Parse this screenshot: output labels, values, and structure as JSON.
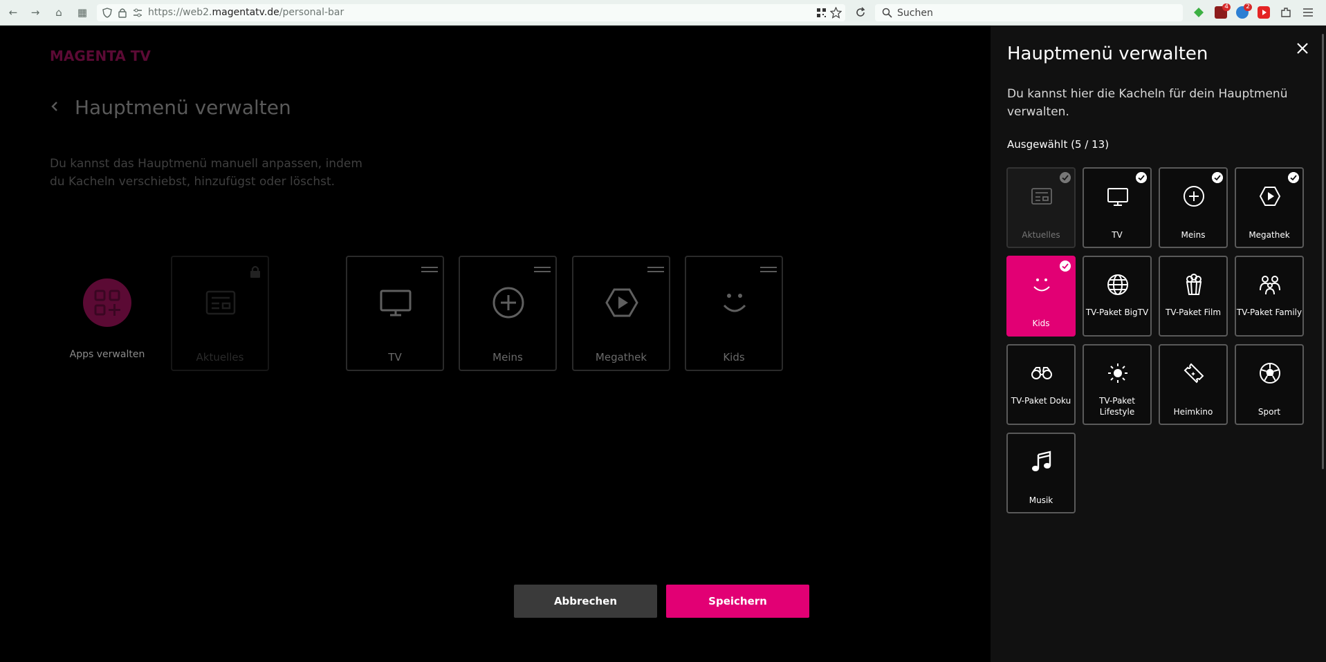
{
  "browser": {
    "url_prefix": "https://web2.",
    "url_domain": "magentatv.de",
    "url_path": "/personal-bar",
    "search_placeholder": "Suchen",
    "badge_1": "4",
    "badge_2": "2"
  },
  "main": {
    "logo": "MAGENTA TV",
    "title": "Hauptmenü verwalten",
    "description": "Du kannst das Hauptmenü manuell anpassen, indem du Kacheln verschiebst, hinzufügst oder löschst.",
    "apps_label": "Apps verwalten",
    "tiles": [
      {
        "label": "Aktuelles",
        "icon": "news-icon",
        "locked": true
      },
      {
        "label": "TV",
        "icon": "tv-icon"
      },
      {
        "label": "Meins",
        "icon": "plus-circle-icon"
      },
      {
        "label": "Megathek",
        "icon": "play-hexagon-icon"
      },
      {
        "label": "Kids",
        "icon": "smiley-icon"
      }
    ],
    "cancel_label": "Abbrechen",
    "save_label": "Speichern"
  },
  "panel": {
    "title": "Hauptmenü verwalten",
    "description": "Du kannst hier die Kacheln für dein Hauptmenü verwalten.",
    "selected_label": "Ausgewählt (5 / 13)",
    "tiles": [
      {
        "label": "Aktuelles",
        "icon": "news-icon",
        "checked": true,
        "disabled": true
      },
      {
        "label": "TV",
        "icon": "tv-icon",
        "checked": true
      },
      {
        "label": "Meins",
        "icon": "plus-circle-icon",
        "checked": true
      },
      {
        "label": "Megathek",
        "icon": "play-hexagon-icon",
        "checked": true
      },
      {
        "label": "Kids",
        "icon": "smiley-icon",
        "checked": true,
        "highlighted": true
      },
      {
        "label": "TV-Paket BigTV",
        "icon": "globe-icon"
      },
      {
        "label": "TV-Paket Film",
        "icon": "popcorn-icon"
      },
      {
        "label": "TV-Paket Family",
        "icon": "family-icon"
      },
      {
        "label": "TV-Paket Doku",
        "icon": "binoculars-icon"
      },
      {
        "label": "TV-Paket Lifestyle",
        "icon": "sun-icon"
      },
      {
        "label": "Heimkino",
        "icon": "ticket-icon"
      },
      {
        "label": "Sport",
        "icon": "soccer-ball-icon"
      },
      {
        "label": "Musik",
        "icon": "music-note-icon"
      }
    ]
  },
  "colors": {
    "magenta": "#e20074",
    "panel_bg": "#111111"
  }
}
